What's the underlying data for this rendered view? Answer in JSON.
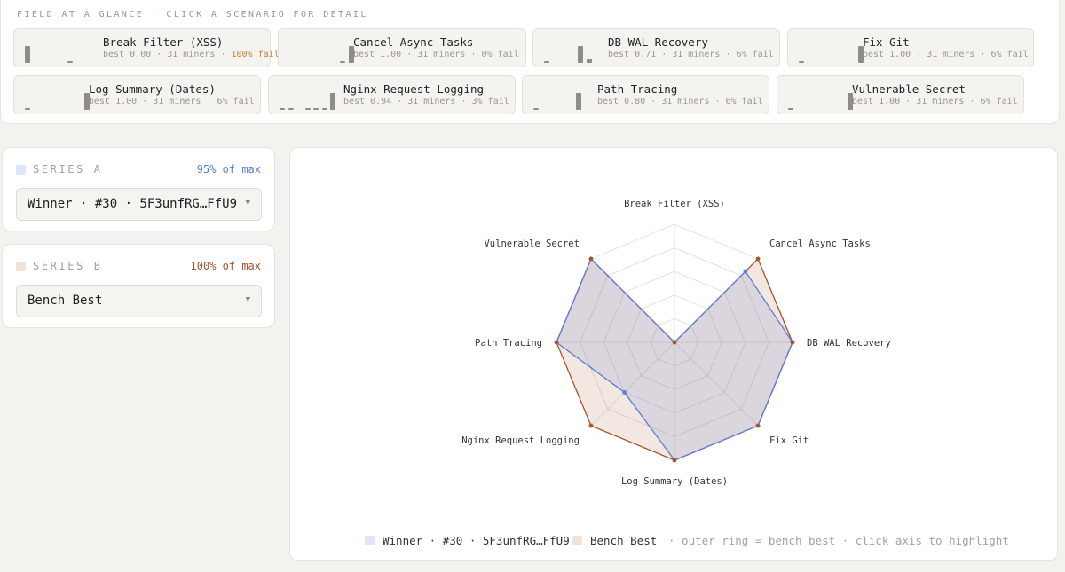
{
  "glance": {
    "title": "FIELD AT A GLANCE · CLICK A SCENARIO FOR DETAIL",
    "scenarios": [
      {
        "name": "Break Filter (XSS)",
        "best": "best 0.00",
        "miners": "31 miners",
        "fail": "100% fail",
        "fail_rate": 1.0,
        "hist": [
          0.55,
          0,
          0,
          0,
          0,
          0.05,
          0,
          0
        ]
      },
      {
        "name": "Cancel Async Tasks",
        "best": "best 1.00",
        "miners": "31 miners",
        "fail": "0% fail",
        "fail_rate": 0.0,
        "hist": [
          0,
          0,
          0,
          0,
          0,
          0,
          0.05,
          0.55
        ]
      },
      {
        "name": "DB WAL Recovery",
        "best": "best 0.71",
        "miners": "31 miners",
        "fail": "6% fail",
        "fail_rate": 0.06,
        "hist": [
          0.05,
          0,
          0,
          0,
          0.55,
          0.15,
          0,
          0
        ]
      },
      {
        "name": "Fix Git",
        "best": "best 1.00",
        "miners": "31 miners",
        "fail": "6% fail",
        "fail_rate": 0.06,
        "hist": [
          0.05,
          0,
          0,
          0,
          0,
          0,
          0,
          0.55
        ]
      },
      {
        "name": "Log Summary (Dates)",
        "best": "best 1.00",
        "miners": "31 miners",
        "fail": "6% fail",
        "fail_rate": 0.06,
        "hist": [
          0.05,
          0,
          0,
          0,
          0,
          0,
          0,
          0.55
        ]
      },
      {
        "name": "Nginx Request Logging",
        "best": "best 0.94",
        "miners": "31 miners",
        "fail": "3% fail",
        "fail_rate": 0.03,
        "hist": [
          0.03,
          0.03,
          0,
          0.03,
          0.03,
          0.05,
          0.55,
          0
        ]
      },
      {
        "name": "Path Tracing",
        "best": "best 0.80",
        "miners": "31 miners",
        "fail": "6% fail",
        "fail_rate": 0.06,
        "hist": [
          0.05,
          0,
          0,
          0,
          0,
          0.55,
          0,
          0
        ]
      },
      {
        "name": "Vulnerable Secret",
        "best": "best 1.00",
        "miners": "31 miners",
        "fail": "6% fail",
        "fail_rate": 0.06,
        "hist": [
          0.05,
          0,
          0,
          0,
          0,
          0,
          0,
          0.55
        ]
      }
    ]
  },
  "series_a": {
    "label": "SERIES A",
    "pct": "95% of max",
    "selected": "Winner · #30 · 5F3unfRG…FfU9",
    "color": "#5b7fd6",
    "swatch": "#dde6f8"
  },
  "series_b": {
    "label": "SERIES B",
    "pct": "100% of max",
    "selected": "Bench Best",
    "color": "#a8552a",
    "swatch": "#f1e2d8"
  },
  "chevron_icon": "chevron-down-icon",
  "chart_data": {
    "type": "radar",
    "axes": [
      "Break Filter (XSS)",
      "Cancel Async Tasks",
      "DB WAL Recovery",
      "Fix Git",
      "Log Summary (Dates)",
      "Nginx Request Logging",
      "Path Tracing",
      "Vulnerable Secret"
    ],
    "range": [
      0,
      1
    ],
    "grid_rings": 5,
    "series": [
      {
        "name": "Winner · #30 · 5F3unfRG…FfU9",
        "values": [
          0.0,
          0.85,
          1.0,
          1.0,
          1.0,
          0.6,
          1.0,
          1.0
        ]
      },
      {
        "name": "Bench Best",
        "values": [
          0.0,
          1.0,
          1.0,
          1.0,
          1.0,
          1.0,
          1.0,
          1.0
        ]
      }
    ],
    "legend": [
      "Winner · #30 · 5F3unfRG…FfU9",
      "Bench Best"
    ],
    "legend_placement": "bottom",
    "hint": "· outer ring = bench best · click axis to highlight"
  }
}
